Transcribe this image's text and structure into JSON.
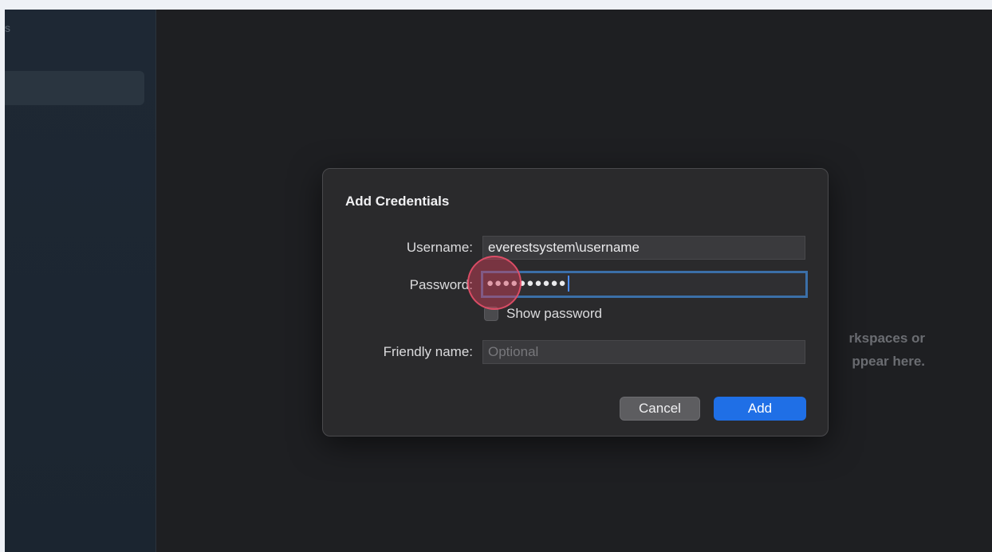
{
  "dialog": {
    "title": "Add Credentials",
    "username_label": "Username:",
    "username_value": "everestsystem\\username",
    "password_label": "Password:",
    "password_dots": "●●●●●●●●●●",
    "show_password_label": "Show password",
    "friendly_name_label": "Friendly name:",
    "friendly_name_placeholder": "Optional",
    "cancel_label": "Cancel",
    "add_label": "Add"
  },
  "background": {
    "empty_line1": "rkspaces or",
    "empty_line2": "ppear here.",
    "sidebar_edge_glyph": "s"
  },
  "colors": {
    "accent": "#1f6fe6",
    "focus_ring": "#3b6fa8",
    "click_marker": "#d6405a"
  }
}
